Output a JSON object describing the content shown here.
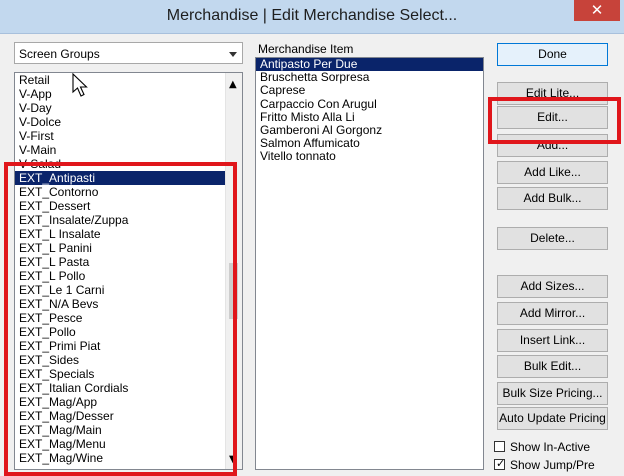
{
  "window": {
    "title": "Merchandise | Edit Merchandise Select...",
    "close_glyph": "✕"
  },
  "screen_groups_select": {
    "selected": "Screen Groups"
  },
  "groups_list": {
    "items": [
      "Retail",
      "V-App",
      "V-Day",
      "V-Dolce",
      "V-First",
      "V-Main",
      "V-Salad",
      "EXT_Antipasti",
      "EXT_Contorno",
      "EXT_Dessert",
      "EXT_Insalate/Zuppa",
      "EXT_L Insalate",
      "EXT_L Panini",
      "EXT_L Pasta",
      "EXT_L Pollo",
      "EXT_Le 1 Carni",
      "EXT_N/A Bevs",
      "EXT_Pesce",
      "EXT_Pollo",
      "EXT_Primi Piat",
      "EXT_Sides",
      "EXT_Specials",
      "EXT_Italian Cordials",
      "EXT_Mag/App",
      "EXT_Mag/Desser",
      "EXT_Mag/Main",
      "EXT_Mag/Menu",
      "EXT_Mag/Wine"
    ],
    "selected_index": 7
  },
  "merchandise_items": {
    "label": "Merchandise Item",
    "items": [
      "Antipasto Per Due",
      "Bruschetta Sorpresa",
      "Caprese",
      "Carpaccio Con Arugul",
      "Fritto Misto Alla Li",
      "Gamberoni Al Gorgonz",
      "Salmon Affumicato",
      "Vitello tonnato"
    ],
    "selected_index": 0
  },
  "buttons": {
    "done": "Done",
    "edit_lite": "Edit Lite...",
    "edit": "Edit...",
    "add": "Add...",
    "add_like": "Add Like...",
    "add_bulk": "Add Bulk...",
    "delete": "Delete...",
    "add_sizes": "Add Sizes...",
    "add_mirror": "Add Mirror...",
    "insert_link": "Insert Link...",
    "bulk_edit": "Bulk Edit...",
    "bulk_size_pricing": "Bulk Size Pricing...",
    "auto_update_pricing": "Auto Update Pricing"
  },
  "checkboxes": {
    "show_inactive": {
      "label": "Show In-Active",
      "checked": false
    },
    "show_jump": {
      "label": "Show Jump/Pre",
      "checked": true,
      "mark": "✓"
    }
  },
  "colors": {
    "highlight": "#e0161b",
    "selection": "#0a246a",
    "accent": "#0078d7"
  }
}
